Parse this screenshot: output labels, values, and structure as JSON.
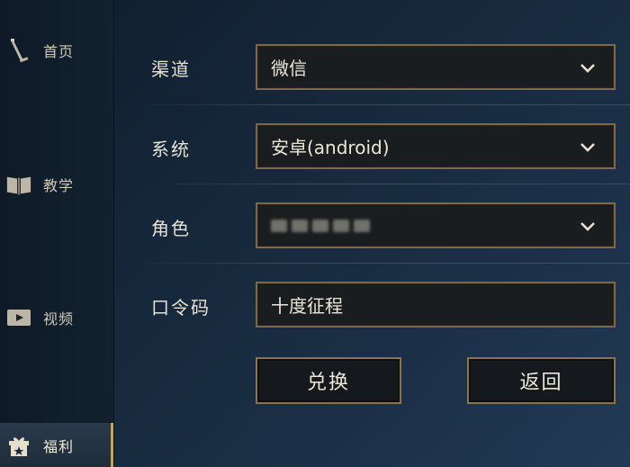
{
  "sidebar": {
    "items": [
      {
        "label": "首页",
        "icon": "sword-icon"
      },
      {
        "label": "教学",
        "icon": "book-icon"
      },
      {
        "label": "视频",
        "icon": "video-icon"
      },
      {
        "label": "福利",
        "icon": "gift-icon"
      }
    ],
    "active_index": 3
  },
  "form": {
    "channel": {
      "label": "渠道",
      "value": "微信"
    },
    "system": {
      "label": "系统",
      "value": "安卓(android)"
    },
    "role": {
      "label": "角色",
      "value": ""
    },
    "code": {
      "label": "口令码",
      "value": "十度征程"
    }
  },
  "buttons": {
    "redeem": "兑换",
    "back": "返回"
  },
  "colors": {
    "border_gold": "#7d6a45",
    "active_accent": "#c9a64e",
    "field_bg": "#1a1d1f"
  }
}
